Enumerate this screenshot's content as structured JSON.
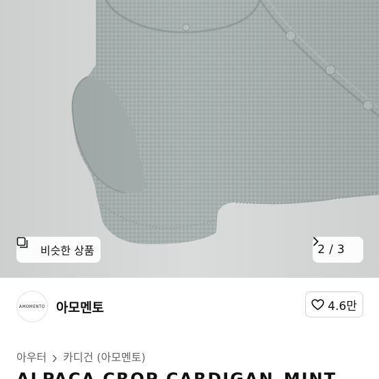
{
  "gallery": {
    "similar_label": "비슷한 상품",
    "page_current": "2",
    "page_sep": "/",
    "page_total": "3"
  },
  "shop": {
    "logo_text": "AMOMENTO",
    "name": "아모멘토",
    "rating": "4.6만"
  },
  "breadcrumb": {
    "items": [
      "아우터",
      "카디건 (아모멘토)"
    ]
  },
  "product": {
    "title": "ALPACA CROP CARDIGAN_MINT"
  },
  "colors": {
    "knit": "#a9b3b1",
    "background": "#dadcdb"
  }
}
